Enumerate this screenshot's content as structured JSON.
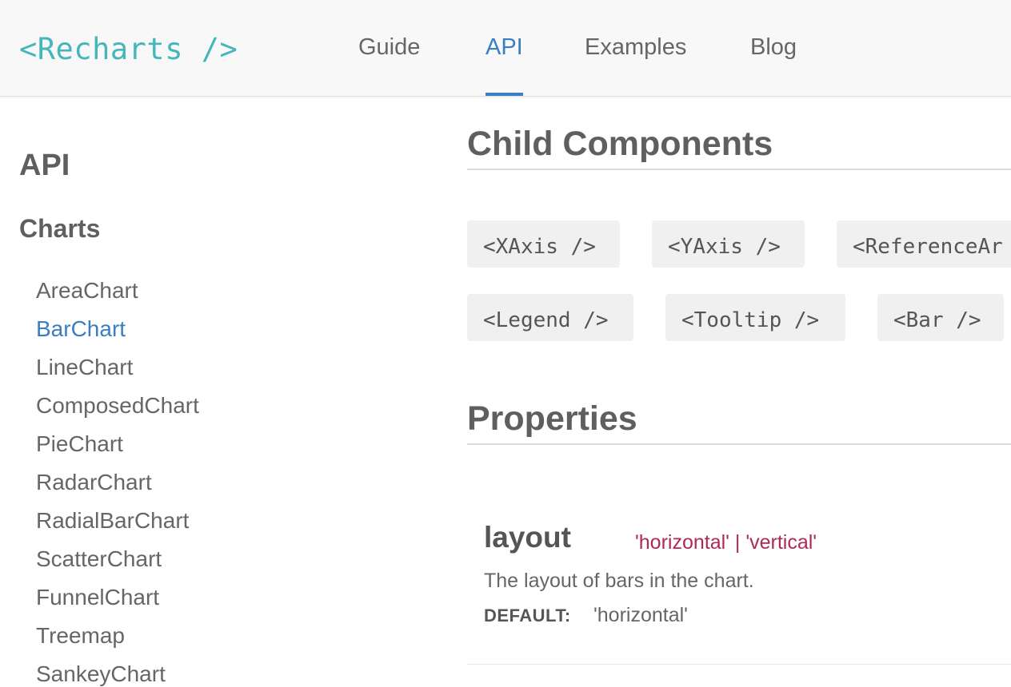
{
  "header": {
    "logo": "<Recharts />",
    "nav": [
      {
        "label": "Guide"
      },
      {
        "label": "API"
      },
      {
        "label": "Examples"
      },
      {
        "label": "Blog"
      }
    ],
    "active_nav": "API"
  },
  "sidebar": {
    "heading": "API",
    "section_heading": "Charts",
    "items": [
      {
        "label": "AreaChart"
      },
      {
        "label": "BarChart"
      },
      {
        "label": "LineChart"
      },
      {
        "label": "ComposedChart"
      },
      {
        "label": "PieChart"
      },
      {
        "label": "RadarChart"
      },
      {
        "label": "RadialBarChart"
      },
      {
        "label": "ScatterChart"
      },
      {
        "label": "FunnelChart"
      },
      {
        "label": "Treemap"
      },
      {
        "label": "SankeyChart"
      }
    ],
    "active_item": "BarChart"
  },
  "main": {
    "child_components_title": "Child Components",
    "child_components": [
      {
        "label": "<XAxis />"
      },
      {
        "label": "<YAxis />"
      },
      {
        "label": "<ReferenceAr"
      },
      {
        "label": "<Legend />"
      },
      {
        "label": "<Tooltip />"
      },
      {
        "label": "<Bar />"
      }
    ],
    "properties_title": "Properties",
    "properties": [
      {
        "name": "layout",
        "type": "'horizontal' | 'vertical'",
        "description": "The layout of bars in the chart.",
        "default_label": "DEFAULT:",
        "default_value": "'horizontal'"
      }
    ]
  },
  "colors": {
    "brand": "#45b6bb",
    "accent": "#3a7ec3",
    "type_text": "#b0285a"
  }
}
